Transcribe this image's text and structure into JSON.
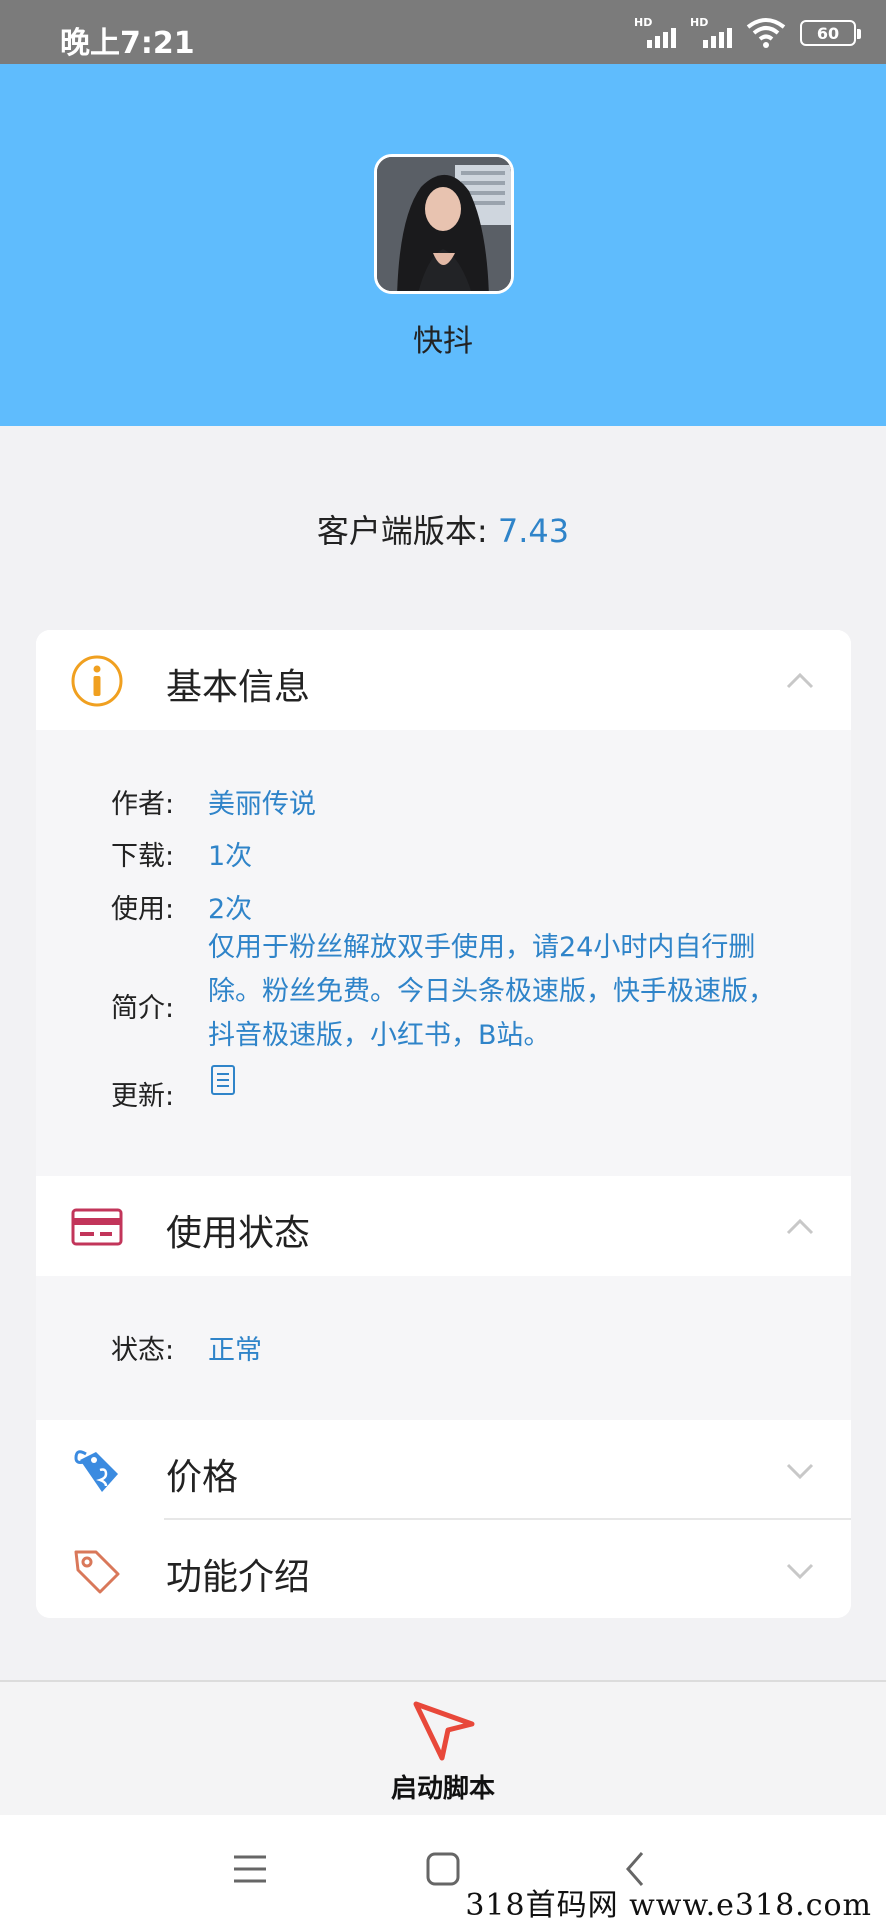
{
  "status_bar": {
    "time": "晚上7:21",
    "hd1": "HD",
    "hd2": "HD",
    "battery": "60"
  },
  "header": {
    "app_name": "快抖"
  },
  "version": {
    "label": "客户端版本: ",
    "value": "7.43"
  },
  "sections": {
    "basic_info": {
      "title": "基本信息",
      "icon": "info-icon",
      "rows": {
        "author": {
          "key": "作者:",
          "value": "美丽传说"
        },
        "downloads": {
          "key": "下载:",
          "value": "1次"
        },
        "uses": {
          "key": "使用:",
          "value": "2次"
        },
        "intro": {
          "key": "简介:",
          "lines": [
            "仅用于粉丝解放双手使用，请24小时内自行删",
            "除。粉丝免费。今日头条极速版，快手极速版，",
            "抖音极速版，小红书，B站。"
          ]
        },
        "update": {
          "key": "更新:",
          "icon": "document-icon"
        }
      }
    },
    "usage_status": {
      "title": "使用状态",
      "icon": "card-icon",
      "rows": {
        "status": {
          "key": "状态:",
          "value": "正常"
        }
      }
    },
    "price": {
      "title": "价格",
      "icon": "price-tag-icon"
    },
    "features": {
      "title": "功能介绍",
      "icon": "tag-icon"
    }
  },
  "action": {
    "label": "启动脚本",
    "icon": "cursor-arrow-icon",
    "color": "#e8483a"
  },
  "nav": {
    "menu_icon": "menu-icon",
    "home_icon": "home-icon",
    "back_icon": "back-icon"
  },
  "watermark": "318首码网  www.e318.com",
  "colors": {
    "header": "#5fbcfd",
    "accent_value": "#2f84c9",
    "info_icon": "#f0a020",
    "card_icon": "#c2355a"
  }
}
